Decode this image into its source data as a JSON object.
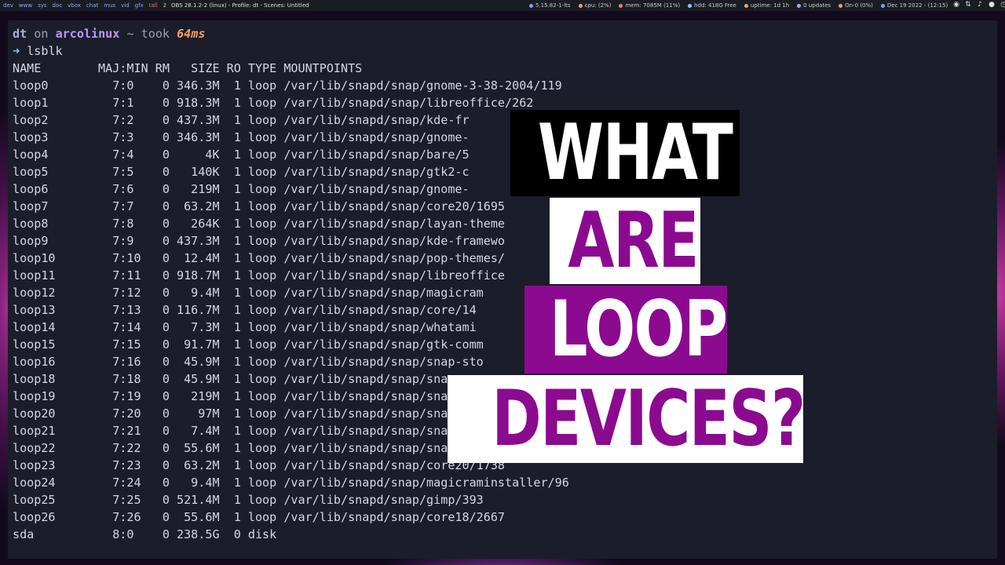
{
  "topbar": {
    "workspaces": [
      "dev",
      "www",
      "sys",
      "doc",
      "vbox",
      "chat",
      "mus",
      "vid",
      "gfx"
    ],
    "layout": "tall",
    "window_count": "2",
    "window_title": "OBS 28.1.2-2 (linux) - Profile: dt - Scenes: Untitled",
    "widgets": [
      {
        "label": "5.15.82-1-lts",
        "color": "#7aa2f7"
      },
      {
        "label": "cpu: (2%)",
        "color": "#ff9e64"
      },
      {
        "label": "mem: 7085M (11%)",
        "color": "#f7768e"
      },
      {
        "label": "hdd: 418G Free",
        "color": "#7dcfff"
      },
      {
        "label": "uptime: 1d 1h",
        "color": "#e0af68"
      },
      {
        "label": "0 updates",
        "color": "#bb9af7"
      },
      {
        "label": "On-0 (0%)",
        "color": "#ff9e64"
      },
      {
        "label": "Dec 19 2022 - (12:15)",
        "color": "#7aa2f7"
      }
    ],
    "tray_icons": [
      "obs-icon",
      "network-icon",
      "volume-icon",
      "mic-icon",
      "clock-icon",
      "power-icon"
    ]
  },
  "terminal": {
    "prompt": {
      "user": "dt",
      "on": "on",
      "host": "arcolinux",
      "path": "~",
      "took": "took",
      "duration": "64ms",
      "arrow": "➜",
      "command": "lsblk"
    },
    "header": "NAME        MAJ:MIN RM   SIZE RO TYPE MOUNTPOINTS",
    "rows": [
      "loop0         7:0    0 346.3M  1 loop /var/lib/snapd/snap/gnome-3-38-2004/119",
      "loop1         7:1    0 918.3M  1 loop /var/lib/snapd/snap/libreoffice/262",
      "loop2         7:2    0 437.3M  1 loop /var/lib/snapd/snap/kde-fr                         20/3",
      "loop3         7:3    0 346.3M  1 loop /var/lib/snapd/snap/gnome-",
      "loop4         7:4    0     4K  1 loop /var/lib/snapd/snap/bare/5",
      "loop5         7:5    0   140K  1 loop /var/lib/snapd/snap/gtk2-c",
      "loop6         7:6    0   219M  1 loop /var/lib/snapd/snap/gnome-",
      "loop7         7:7    0  63.2M  1 loop /var/lib/snapd/snap/core20/1695",
      "loop8         7:8    0   264K  1 loop /var/lib/snapd/snap/layan-theme",
      "loop9         7:9    0 437.3M  1 loop /var/lib/snapd/snap/kde-framewo             -core20/7",
      "loop10        7:10   0  12.4M  1 loop /var/lib/snapd/snap/pop-themes/",
      "loop11        7:11   0 918.7M  1 loop /var/lib/snapd/snap/libreoffice",
      "loop12        7:12   0   9.4M  1 loop /var/lib/snapd/snap/magicram",
      "loop13        7:13   0 116.7M  1 loop /var/lib/snapd/snap/core/14",
      "loop14        7:14   0   7.3M  1 loop /var/lib/snapd/snap/whatami",
      "loop15        7:15   0  91.7M  1 loop /var/lib/snapd/snap/gtk-comm",
      "loop16        7:16   0  45.9M  1 loop /var/lib/snapd/snap/snap-sto",
      "loop18        7:18   0  45.9M  1 loop /var/lib/snapd/snap/sna",
      "loop19        7:19   0   219M  1 loop /var/lib/snapd/snap/sna",
      "loop20        7:20   0    97M  1 loop /var/lib/snapd/snap/sna",
      "loop21        7:21   0   7.4M  1 loop /var/lib/snapd/snap/sna",
      "loop22        7:22   0  55.6M  1 loop /var/lib/snapd/snap/sna",
      "loop23        7:23   0  63.2M  1 loop /var/lib/snapd/snap/core20/1738",
      "loop24        7:24   0   9.4M  1 loop /var/lib/snapd/snap/magicraminstaller/96",
      "loop25        7:25   0 521.4M  1 loop /var/lib/snapd/snap/gimp/393",
      "loop26        7:26   0  55.6M  1 loop /var/lib/snapd/snap/core18/2667",
      "sda           8:0    0 238.5G  0 disk"
    ]
  },
  "overlay": {
    "line1": "WHAT",
    "line2": "ARE",
    "line3": "LOOP",
    "line4": "DEVICES?",
    "colors": {
      "purple": "#8b0a8f",
      "white": "#ffffff",
      "black": "#000000"
    }
  }
}
